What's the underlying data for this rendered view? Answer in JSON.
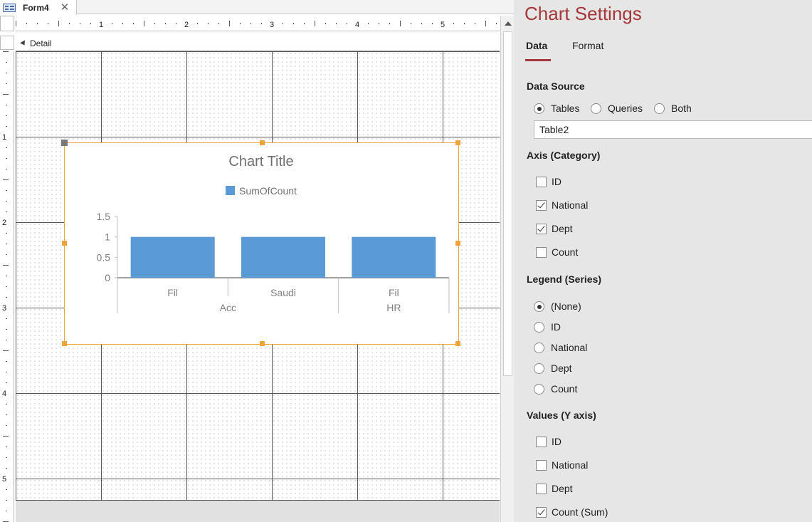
{
  "tab": {
    "label": "Form4",
    "icon": "form-icon",
    "close_icon": "close-icon"
  },
  "ruler": {
    "h_marks": [
      "1",
      "2",
      "3",
      "4",
      "5"
    ],
    "v_marks": [
      "1",
      "2",
      "3",
      "4",
      "5"
    ]
  },
  "section": {
    "detail_label": "Detail",
    "detail_icon": "section-arrow-icon"
  },
  "chart_data": {
    "type": "bar",
    "title": "Chart Title",
    "categories": [
      "Fil",
      "Saudi",
      "Fil"
    ],
    "group_labels": [
      "Acc",
      "HR"
    ],
    "groups": [
      [
        "Fil",
        "Saudi"
      ],
      [
        "Fil"
      ]
    ],
    "series": [
      {
        "name": "SumOfCount",
        "values": [
          1,
          1,
          1
        ]
      }
    ],
    "yticks": [
      "0",
      "0.5",
      "1",
      "1.5"
    ],
    "ylim": [
      0,
      1.5
    ],
    "legend": "top",
    "bar_color": "#5b9bd5"
  },
  "settings": {
    "title": "Chart Settings",
    "tabs": {
      "data": "Data",
      "format": "Format"
    },
    "accent": "#a4373a",
    "data_source": {
      "heading": "Data Source",
      "options": [
        {
          "label": "Tables",
          "checked": true
        },
        {
          "label": "Queries",
          "checked": false
        },
        {
          "label": "Both",
          "checked": false
        }
      ],
      "selected_table": "Table2"
    },
    "axis": {
      "heading": "Axis (Category)",
      "items": [
        {
          "label": "ID",
          "checked": false
        },
        {
          "label": "National",
          "checked": true
        },
        {
          "label": "Dept",
          "checked": true
        },
        {
          "label": "Count",
          "checked": false
        }
      ]
    },
    "legend": {
      "heading": "Legend (Series)",
      "items": [
        {
          "label": "(None)",
          "checked": true
        },
        {
          "label": "ID",
          "checked": false
        },
        {
          "label": "National",
          "checked": false
        },
        {
          "label": "Dept",
          "checked": false
        },
        {
          "label": "Count",
          "checked": false
        }
      ]
    },
    "values": {
      "heading": "Values (Y axis)",
      "items": [
        {
          "label": "ID",
          "checked": false
        },
        {
          "label": "National",
          "checked": false
        },
        {
          "label": "Dept",
          "checked": false
        },
        {
          "label": "Count (Sum)",
          "checked": true
        }
      ]
    }
  }
}
